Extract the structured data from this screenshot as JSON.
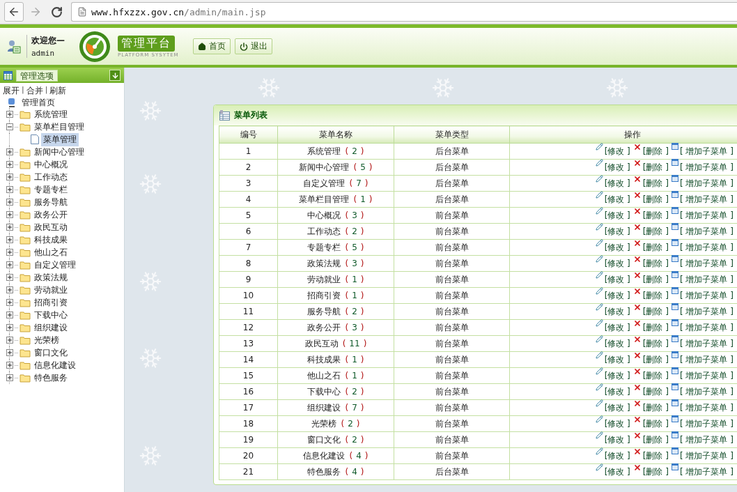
{
  "browser": {
    "url_host": "www.hfxzzx.gov.cn",
    "url_path": "/admin/main.jsp"
  },
  "header": {
    "welcome": "欢迎您—",
    "user": "admin",
    "title": "管理平台",
    "subtitle": "PLATFORM SYSYTEM",
    "buttons": [
      {
        "kind": "home",
        "label": "首页"
      },
      {
        "kind": "logout",
        "label": "退出"
      }
    ]
  },
  "sidebar": {
    "title": "管理选项",
    "links": [
      {
        "kind": "link",
        "label": "展开"
      },
      {
        "kind": "sep",
        "label": "|"
      },
      {
        "kind": "link",
        "label": "合并"
      },
      {
        "kind": "sep",
        "label": "|"
      },
      {
        "kind": "link",
        "label": "刷新"
      }
    ],
    "root": "管理首页",
    "items": [
      {
        "label": "系统管理",
        "expanded": false,
        "selected": false
      },
      {
        "label": "菜单栏目管理",
        "expanded": true,
        "selected": false,
        "children": [
          {
            "label": "菜单管理",
            "selected": true
          }
        ]
      },
      {
        "label": "新闻中心管理",
        "expanded": false,
        "selected": false
      },
      {
        "label": "中心概况",
        "expanded": false,
        "selected": false
      },
      {
        "label": "工作动态",
        "expanded": false,
        "selected": false
      },
      {
        "label": "专题专栏",
        "expanded": false,
        "selected": false
      },
      {
        "label": "服务导航",
        "expanded": false,
        "selected": false
      },
      {
        "label": "政务公开",
        "expanded": false,
        "selected": false
      },
      {
        "label": "政民互动",
        "expanded": false,
        "selected": false
      },
      {
        "label": "科技成果",
        "expanded": false,
        "selected": false
      },
      {
        "label": "他山之石",
        "expanded": false,
        "selected": false
      },
      {
        "label": "自定义管理",
        "expanded": false,
        "selected": false
      },
      {
        "label": "政策法规",
        "expanded": false,
        "selected": false
      },
      {
        "label": "劳动就业",
        "expanded": false,
        "selected": false
      },
      {
        "label": "招商引资",
        "expanded": false,
        "selected": false
      },
      {
        "label": "下载中心",
        "expanded": false,
        "selected": false
      },
      {
        "label": "组织建设",
        "expanded": false,
        "selected": false
      },
      {
        "label": "光荣榜",
        "expanded": false,
        "selected": false
      },
      {
        "label": "窗口文化",
        "expanded": false,
        "selected": false
      },
      {
        "label": "信息化建设",
        "expanded": false,
        "selected": false
      },
      {
        "label": "特色服务",
        "expanded": false,
        "selected": false
      }
    ]
  },
  "panel": {
    "title": "菜单列表",
    "table": {
      "columns": [
        "编号",
        "菜单名称",
        "菜单类型",
        "操作"
      ],
      "rows": [
        {
          "id": "1",
          "name": "系统管理",
          "count": [
            "(",
            "2",
            ")"
          ],
          "type": "后台菜单",
          "actions": [
            "[修改 ]",
            "[删除 ]",
            "[ 增加子菜单 ]"
          ]
        },
        {
          "id": "2",
          "name": "新闻中心管理",
          "count": [
            "(",
            "5",
            ")"
          ],
          "type": "后台菜单",
          "actions": [
            "[修改 ]",
            "[删除 ]",
            "[ 增加子菜单 ]"
          ]
        },
        {
          "id": "3",
          "name": "自定义管理",
          "count": [
            "(",
            "7",
            ")"
          ],
          "type": "后台菜单",
          "actions": [
            "[修改 ]",
            "[删除 ]",
            "[ 增加子菜单 ]"
          ]
        },
        {
          "id": "4",
          "name": "菜单栏目管理",
          "count": [
            "(",
            "1",
            ")"
          ],
          "type": "后台菜单",
          "actions": [
            "[修改 ]",
            "[删除 ]",
            "[ 增加子菜单 ]"
          ]
        },
        {
          "id": "5",
          "name": "中心概况",
          "count": [
            "(",
            "3",
            ")"
          ],
          "type": "前台菜单",
          "actions": [
            "[修改 ]",
            "[删除 ]",
            "[ 增加子菜单 ]"
          ]
        },
        {
          "id": "6",
          "name": "工作动态",
          "count": [
            "(",
            "2",
            ")"
          ],
          "type": "前台菜单",
          "actions": [
            "[修改 ]",
            "[删除 ]",
            "[ 增加子菜单 ]"
          ]
        },
        {
          "id": "7",
          "name": "专题专栏",
          "count": [
            "(",
            "5",
            ")"
          ],
          "type": "前台菜单",
          "actions": [
            "[修改 ]",
            "[删除 ]",
            "[ 增加子菜单 ]"
          ]
        },
        {
          "id": "8",
          "name": "政策法规",
          "count": [
            "(",
            "3",
            ")"
          ],
          "type": "前台菜单",
          "actions": [
            "[修改 ]",
            "[删除 ]",
            "[ 增加子菜单 ]"
          ]
        },
        {
          "id": "9",
          "name": "劳动就业",
          "count": [
            "(",
            "1",
            ")"
          ],
          "type": "前台菜单",
          "actions": [
            "[修改 ]",
            "[删除 ]",
            "[ 增加子菜单 ]"
          ]
        },
        {
          "id": "10",
          "name": "招商引资",
          "count": [
            "(",
            "1",
            ")"
          ],
          "type": "前台菜单",
          "actions": [
            "[修改 ]",
            "[删除 ]",
            "[ 增加子菜单 ]"
          ]
        },
        {
          "id": "11",
          "name": "服务导航",
          "count": [
            "(",
            "2",
            ")"
          ],
          "type": "前台菜单",
          "actions": [
            "[修改 ]",
            "[删除 ]",
            "[ 增加子菜单 ]"
          ]
        },
        {
          "id": "12",
          "name": "政务公开",
          "count": [
            "(",
            "3",
            ")"
          ],
          "type": "前台菜单",
          "actions": [
            "[修改 ]",
            "[删除 ]",
            "[ 增加子菜单 ]"
          ]
        },
        {
          "id": "13",
          "name": "政民互动",
          "count": [
            "(",
            "11",
            ")"
          ],
          "type": "前台菜单",
          "actions": [
            "[修改 ]",
            "[删除 ]",
            "[ 增加子菜单 ]"
          ]
        },
        {
          "id": "14",
          "name": "科技成果",
          "count": [
            "(",
            "1",
            ")"
          ],
          "type": "前台菜单",
          "actions": [
            "[修改 ]",
            "[删除 ]",
            "[ 增加子菜单 ]"
          ]
        },
        {
          "id": "15",
          "name": "他山之石",
          "count": [
            "(",
            "1",
            ")"
          ],
          "type": "前台菜单",
          "actions": [
            "[修改 ]",
            "[删除 ]",
            "[ 增加子菜单 ]"
          ]
        },
        {
          "id": "16",
          "name": "下载中心",
          "count": [
            "(",
            "2",
            ")"
          ],
          "type": "前台菜单",
          "actions": [
            "[修改 ]",
            "[删除 ]",
            "[ 增加子菜单 ]"
          ]
        },
        {
          "id": "17",
          "name": "组织建设",
          "count": [
            "(",
            "7",
            ")"
          ],
          "type": "前台菜单",
          "actions": [
            "[修改 ]",
            "[删除 ]",
            "[ 增加子菜单 ]"
          ]
        },
        {
          "id": "18",
          "name": "光荣榜",
          "count": [
            "(",
            "2",
            ")"
          ],
          "type": "前台菜单",
          "actions": [
            "[修改 ]",
            "[删除 ]",
            "[ 增加子菜单 ]"
          ]
        },
        {
          "id": "19",
          "name": "窗口文化",
          "count": [
            "(",
            "2",
            ")"
          ],
          "type": "前台菜单",
          "actions": [
            "[修改 ]",
            "[删除 ]",
            "[ 增加子菜单 ]"
          ]
        },
        {
          "id": "20",
          "name": "信息化建设",
          "count": [
            "(",
            "4",
            ")"
          ],
          "type": "前台菜单",
          "actions": [
            "[修改 ]",
            "[删除 ]",
            "[ 增加子菜单 ]"
          ]
        },
        {
          "id": "21",
          "name": "特色服务",
          "count": [
            "(",
            "4",
            ")"
          ],
          "type": "后台菜单",
          "actions": [
            "[修改 ]",
            "[删除 ]",
            "[ 增加子菜单 ]"
          ]
        }
      ]
    }
  }
}
